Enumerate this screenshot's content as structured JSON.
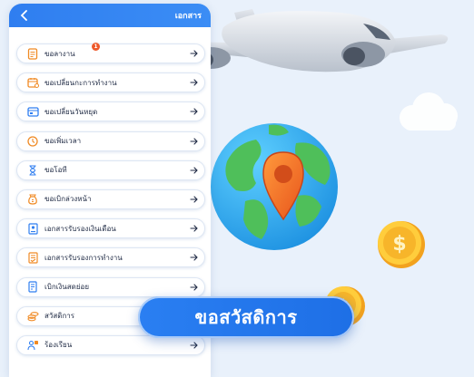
{
  "header": {
    "title": "เอกสาร"
  },
  "menu": [
    {
      "label": "ขอลางาน",
      "icon": "document-icon",
      "badge": "1"
    },
    {
      "label": "ขอเปลี่ยนกะการทำงาน",
      "icon": "shift-calendar-icon"
    },
    {
      "label": "ขอเปลี่ยนวันหยุด",
      "icon": "holiday-calendar-icon"
    },
    {
      "label": "ขอเพิ่มเวลา",
      "icon": "clock-icon"
    },
    {
      "label": "ขอโอที",
      "icon": "hourglass-icon"
    },
    {
      "label": "ขอเบิกล่วงหน้า",
      "icon": "money-bag-icon"
    },
    {
      "label": "เอกสารรับรองเงินเดือน",
      "icon": "salary-certificate-icon"
    },
    {
      "label": "เอกสารรับรองการทำงาน",
      "icon": "work-certificate-icon"
    },
    {
      "label": "เบิกเงินสดย่อย",
      "icon": "petty-cash-icon"
    },
    {
      "label": "สวัสดิการ",
      "icon": "coins-icon"
    },
    {
      "label": "ร้องเรียน",
      "icon": "complaint-icon"
    }
  ],
  "welfare_banner": {
    "label": "ขอสวัสดิการ"
  },
  "colors": {
    "primary_blue": "#2f7ef0",
    "icon_orange": "#f08a24",
    "badge_red": "#ee5a2c",
    "background": "#e9f1fb"
  }
}
